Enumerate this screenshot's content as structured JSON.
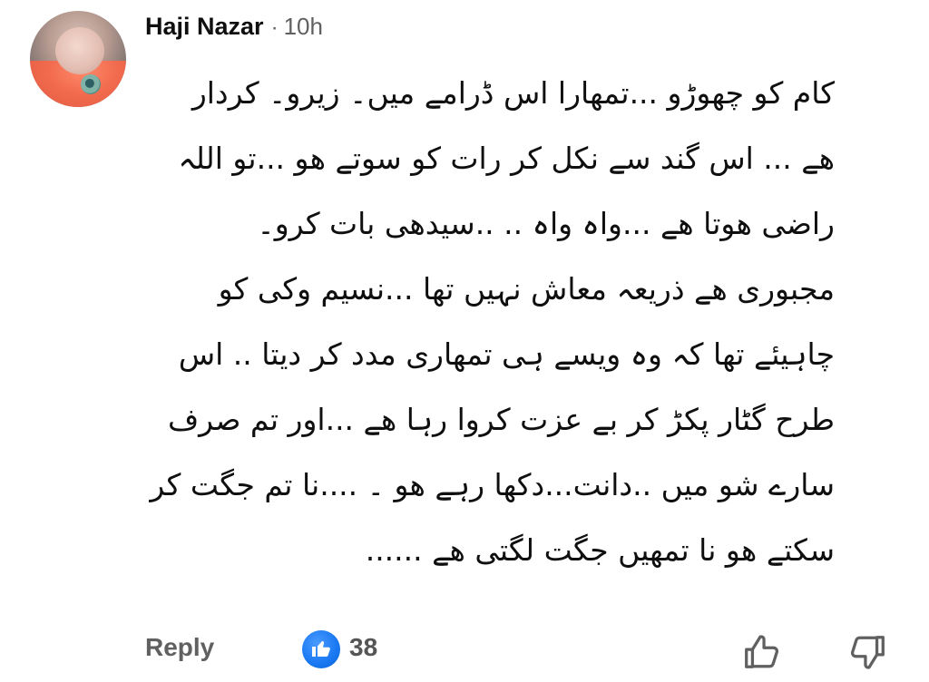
{
  "comment": {
    "author": "Haji Nazar",
    "separator": "·",
    "time": "10h",
    "lines": [
      "کام کو چھوڑو ...تمھارا اس ڈرامے میں۔ زیرو۔ کردار",
      "ھے ... اس گند سے نکل کر رات کو سوتے ھو ...تو اللہ",
      "راضی ھوتا ھے ...واہ واہ .. ..سیدھی بات کرو۔",
      "مجبوری ھے ذریعہ معاش نہیں تھا ...نسیم وکی کو",
      "چاہیئے تھا کہ وہ ویسے ہی تمھاری مدد کر دیتا .. اس",
      "طرح گٹار پکڑ کر بے عزت کروا رہا ھے ...اور تم صرف",
      "سارے شو میں ..دانت...دکھا رہے ھو ۔ ....نا تم جگت کر",
      "سکتے ھو نا تمھیں جگت لگتی ھے ......"
    ]
  },
  "actions": {
    "reply_label": "Reply",
    "like_count": "38",
    "like_badge_color": "#1877f2"
  },
  "icons": {
    "avatar": "avatar-photo",
    "reaction": "thumbs-up-reaction-icon",
    "like": "thumbs-up-outline-icon",
    "dislike": "thumbs-down-outline-icon"
  }
}
